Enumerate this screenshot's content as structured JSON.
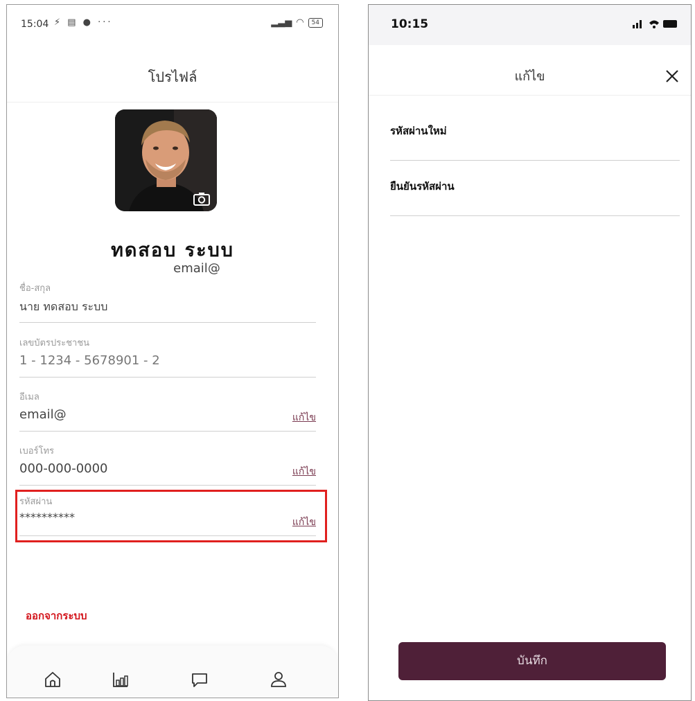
{
  "left": {
    "status_bar": {
      "time": "15:04",
      "battery": "54"
    },
    "header": {
      "title": "โปรไฟล์"
    },
    "profile": {
      "name": "ทดสอบ   ระบบ",
      "email": "email@"
    },
    "fields": [
      {
        "label": "ชื่อ-สกุล",
        "value": "นาย ทดสอบ ระบบ"
      },
      {
        "label": "เลขบัตรประชาชน",
        "value": "1 - 1234 - 5678901 - 2"
      },
      {
        "label": "อีเมล",
        "value": "email@",
        "edit": "แก้ไข"
      },
      {
        "label": "เบอร์โทร",
        "value": "000-000-0000",
        "edit": "แก้ไข"
      },
      {
        "label": "รหัสผ่าน",
        "value": "**********",
        "edit": "แก้ไข"
      }
    ],
    "logout": "ออกจากระบบ",
    "tabs": [
      "home-icon",
      "chart-icon",
      "chat-icon",
      "profile-icon"
    ]
  },
  "right": {
    "status_bar": {
      "time": "10:15"
    },
    "header": {
      "title": "แก้ไข"
    },
    "fields": [
      {
        "label": "รหัสผ่านใหม่"
      },
      {
        "label": "ยืนยันรหัสผ่าน"
      }
    ],
    "save_label": "บันทึก"
  },
  "colors": {
    "accent": "#4f2038",
    "danger": "#d3151c",
    "highlight": "#e0201f"
  }
}
